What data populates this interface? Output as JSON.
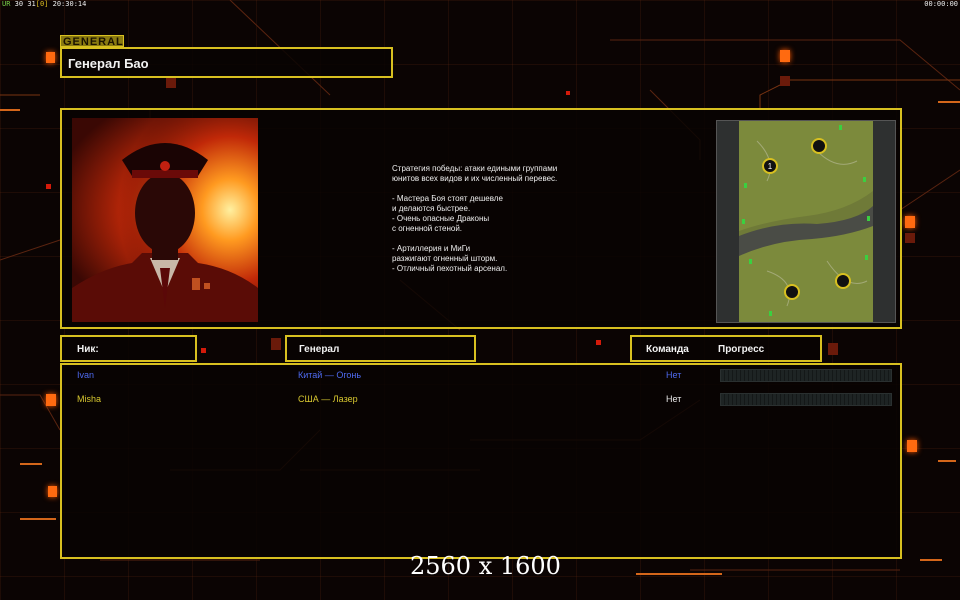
{
  "status": {
    "left_prefix": "UR",
    "fps": "30",
    "frame": "31",
    "latency": "[0]",
    "time": "20:30:14",
    "right_time": "00:00:00"
  },
  "general": {
    "tag": "GENERAL",
    "name": "Генерал Бао",
    "strategy": "Стратегия победы: атаки едиными группами\nюнитов всех видов и их численный перевес.\n\n- Мастера Боя стоят дешевле\nи делаются быстрее.\n- Очень опасные Драконы\nс огненной стеной.\n\n- Артиллерия и МиГи\nразжигают огненный шторм.\n- Отличный пехотный арсенал."
  },
  "map": {
    "marker_label": "1"
  },
  "table": {
    "nick_label": "Ник:",
    "general_label": "Генерал",
    "team_label": "Команда",
    "progress_label": "Прогресс",
    "rows": [
      {
        "nick": "Ivan",
        "general": "Китай — Огонь",
        "team": "Нет",
        "color": "#4e6af0",
        "progress": 0
      },
      {
        "nick": "Misha",
        "general": "США — Лазер",
        "team": "Нет",
        "color": "#d8c830",
        "progress": 0
      }
    ]
  },
  "watermark": "2560 x 1600",
  "colors": {
    "frame": "#d8c020",
    "accent": "#ff6a10",
    "background": "#0b0403"
  }
}
